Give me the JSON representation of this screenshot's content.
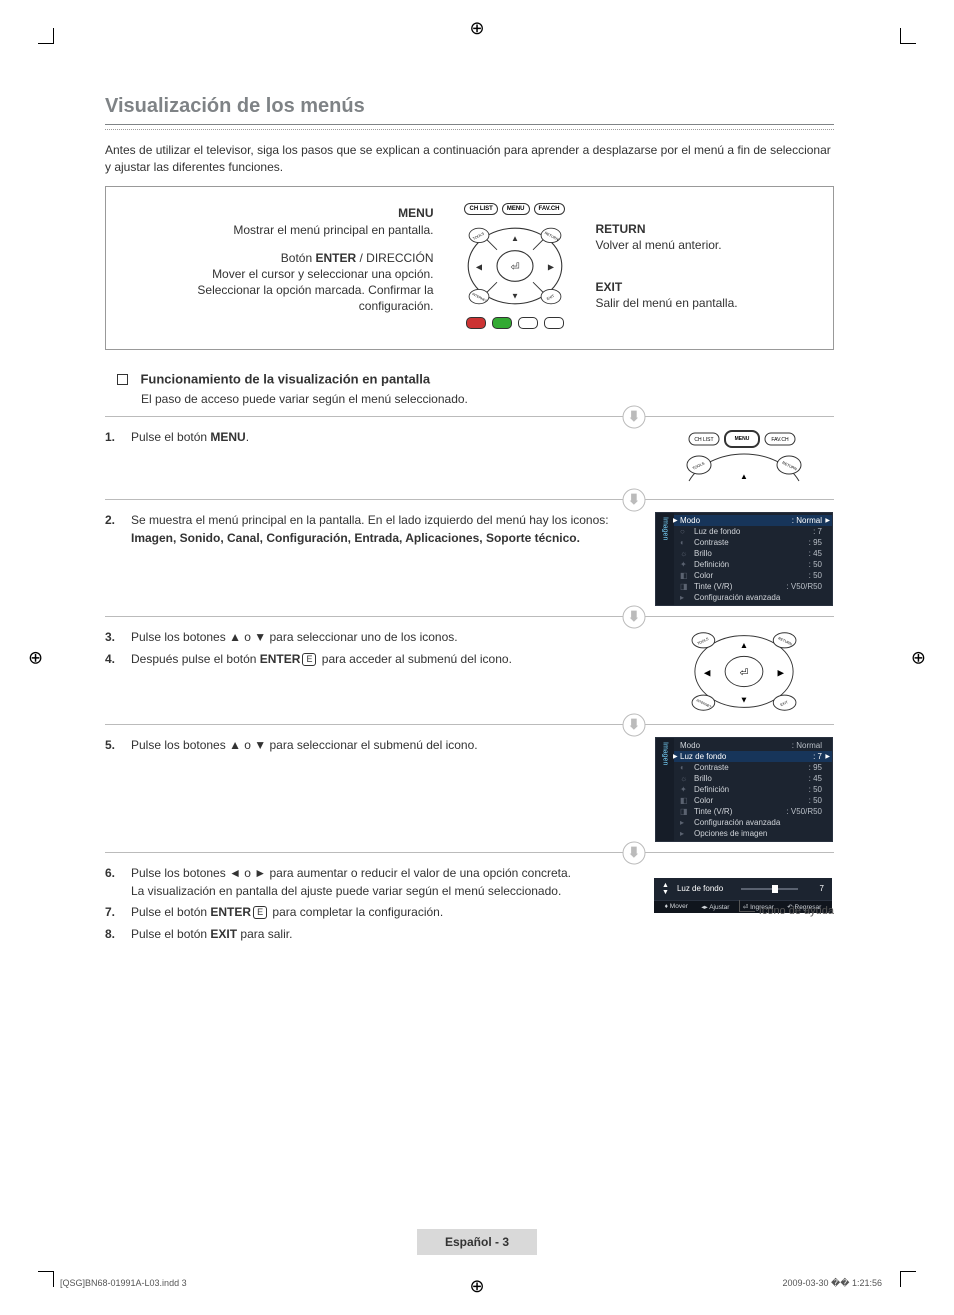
{
  "title": "Visualización de los menús",
  "intro": "Antes de utilizar el televisor, siga los pasos que se explican a continuación para aprender a desplazarse por el menú a fin de seleccionar y ajustar las diferentes funciones.",
  "remote_top_buttons": {
    "chlist": "CH LIST",
    "menu": "MENU",
    "favch": "FAV.CH"
  },
  "remote_corners": {
    "tools": "TOOLS",
    "return": "RETURN",
    "internet": "INTERNET",
    "exit": "EXIT"
  },
  "menu_callout": {
    "title": "MENU",
    "text": "Mostrar el menú principal en pantalla."
  },
  "enter_callout": {
    "title_pre": "Botón ",
    "title_bold": "ENTER",
    "title_post": " / DIRECCIÓN",
    "line1": "Mover el cursor y seleccionar una opción.",
    "line2": "Seleccionar la opción marcada. Confirmar la configuración."
  },
  "return_callout": {
    "title": "RETURN",
    "text": "Volver al menú anterior."
  },
  "exit_callout": {
    "title": "EXIT",
    "text": "Salir del menú en pantalla."
  },
  "sub_heading": "Funcionamiento de la visualización en pantalla",
  "sub_text": "El paso de acceso puede variar según el menú seleccionado.",
  "step1": {
    "num": "1.",
    "pre": "Pulse el botón ",
    "bold": "MENU",
    "post": "."
  },
  "step2": {
    "num": "2.",
    "line1": "Se muestra el menú principal en la pantalla. En el lado izquierdo del menú hay los iconos:",
    "line2": "Imagen, Sonido, Canal, Configuración, Entrada, Aplicaciones, Soporte técnico."
  },
  "step3": {
    "num": "3.",
    "text": "Pulse los botones ▲ o ▼ para seleccionar uno de los iconos."
  },
  "step4": {
    "num": "4.",
    "pre": "Después pulse el botón ",
    "bold": "ENTER",
    "post": " para acceder al submenú del icono."
  },
  "step5": {
    "num": "5.",
    "text": "Pulse los botones ▲ o ▼ para seleccionar el submenú del icono."
  },
  "step6": {
    "num": "6.",
    "line1": "Pulse los botones ◄ o ► para aumentar o reducir el valor de una opción concreta.",
    "line2": "La visualización en pantalla del ajuste puede variar según el menú seleccionado."
  },
  "step7": {
    "num": "7.",
    "pre": "Pulse el botón ",
    "bold": "ENTER",
    "post": " para completar la configuración."
  },
  "step8": {
    "num": "8.",
    "pre": "Pulse el botón ",
    "bold": "EXIT",
    "post": " para salir."
  },
  "osd_side_label": "Imagen",
  "osd_rows": {
    "modo": {
      "label": "Modo",
      "value": ": Normal"
    },
    "luz": {
      "label": "Luz de fondo",
      "value": ": 7"
    },
    "contraste": {
      "label": "Contraste",
      "value": ": 95"
    },
    "brillo": {
      "label": "Brillo",
      "value": ": 45"
    },
    "definicion": {
      "label": "Definición",
      "value": ": 50"
    },
    "color": {
      "label": "Color",
      "value": ": 50"
    },
    "tinte": {
      "label": "Tinte (V/R)",
      "value": ": V50/R50"
    },
    "avanzada": {
      "label": "Configuración avanzada",
      "value": ""
    },
    "opciones": {
      "label": "Opciones de imagen",
      "value": ""
    }
  },
  "slider": {
    "label": "Luz de fondo",
    "value": "7",
    "actions": {
      "mover": "Mover",
      "ajustar": "Ajustar",
      "ingresar": "Ingresar",
      "regresar": "Regresar"
    }
  },
  "help_icon_label": "Icono de ayuda",
  "page_label": "Español - 3",
  "print_footer": {
    "left": "[QSG]BN68-01991A-L03.indd   3",
    "right": "2009-03-30   �� 1:21:56"
  },
  "enter_glyph": "E"
}
